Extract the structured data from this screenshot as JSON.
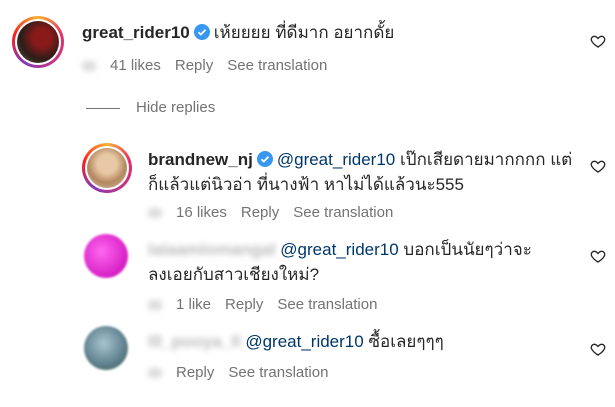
{
  "comments": [
    {
      "username": "great_rider10",
      "verified": true,
      "text": "เห้ยยยย ที่ดีมาก อยากดั้ย",
      "likes": "41 likes",
      "reply": "Reply",
      "see_translation": "See translation",
      "avatar_color": "#3a1f1a"
    }
  ],
  "hide_replies": "Hide replies",
  "replies": [
    {
      "username": "brandnew_nj",
      "verified": true,
      "mention": "@great_rider10",
      "text_line1": "เป๊กเสียดายมากกกก แต่",
      "text_line2": "ก็แล้วแต่นิวอ่า ที่นางฟ้า หาไม่ได้แล้วนะ555",
      "likes": "16 likes",
      "reply": "Reply",
      "see_translation": "See translation",
      "avatar_color": "#c9a27a"
    },
    {
      "username": "lalaamlomangal",
      "mention": "@great_rider10",
      "text_line1": "บอกเป็นนัยๆว่าจะ",
      "text_line2": "ลงเอยกับสาวเชียงใหม่?",
      "likes": "1 like",
      "reply": "Reply",
      "see_translation": "See translation",
      "avatar_color": "#e84bd6"
    },
    {
      "username": "lll_pooya_ll",
      "mention": "@great_rider10",
      "text_line1": "ซื้อเลยๆๆๆ",
      "reply": "Reply",
      "see_translation": "See translation",
      "avatar_color": "#6f8fa0"
    }
  ]
}
